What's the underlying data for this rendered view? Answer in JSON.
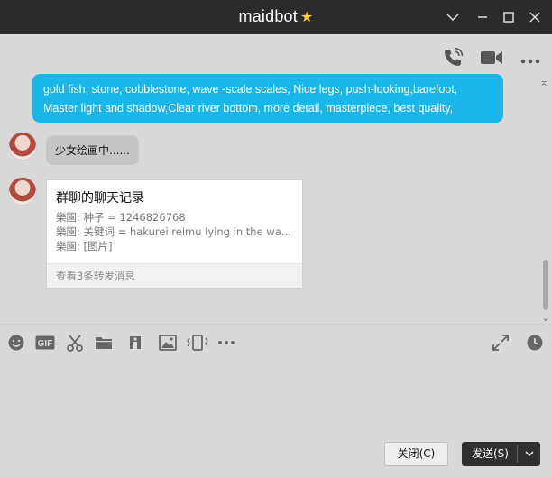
{
  "window": {
    "title": "maidbot",
    "title_icon": "star-icon"
  },
  "window_controls": [
    "chevron-down-icon",
    "minimize-icon",
    "maximize-icon",
    "close-icon"
  ],
  "chat_actions": [
    "phone-icon",
    "video-icon",
    "more-icon"
  ],
  "messages": {
    "sent_prompt": {
      "line1": "gold fish, stone, cobblestone, wave -scale scales, Nice legs, push-looking,barefoot,",
      "line2": "Master light and shadow,Clear river bottom, more detail, masterpiece, best quality,"
    },
    "bot_status": "少女绘画中......",
    "forward_card": {
      "title": "群聊的聊天记录",
      "lines": [
        "樂園: 种子 = 1246826768",
        "樂園: 关键词 = hakurei reimu lying in the wat...",
        "樂園: [图片]"
      ],
      "footer": "查看3条转发消息"
    }
  },
  "toolbar_icons": [
    "emoji-icon",
    "gif-icon",
    "scissors-icon",
    "folder-icon",
    "sticker-icon",
    "image-icon",
    "shake-icon",
    "more-tools-icon",
    "expand-icon",
    "history-icon"
  ],
  "buttons": {
    "close": "关闭(C)",
    "send": "发送(S)"
  },
  "colors": {
    "accent_blue": "#1ab6ea",
    "titlebar": "#2b2b2b",
    "star": "#ffcc33"
  }
}
